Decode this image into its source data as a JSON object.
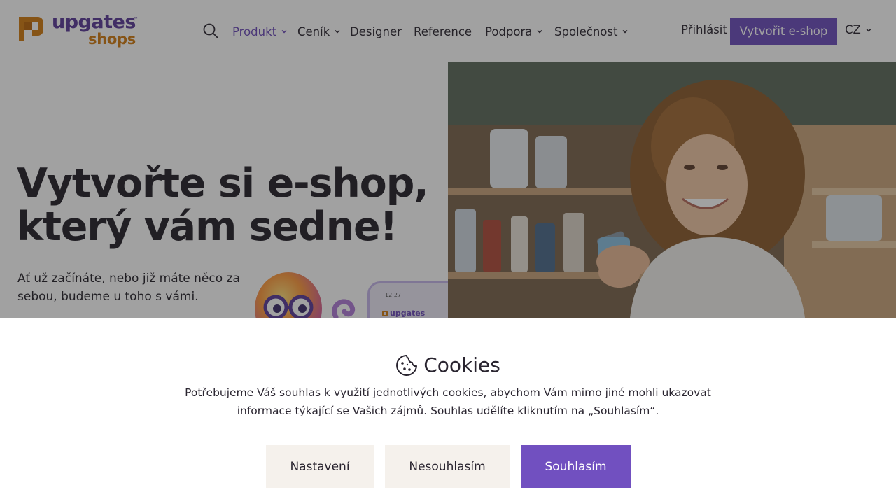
{
  "header": {
    "logo_word": "upgates",
    "logo_tm": "™",
    "logo_sub": "shops",
    "nav": [
      {
        "label": "Produkt",
        "dropdown": true,
        "active": true
      },
      {
        "label": "Ceník",
        "dropdown": true
      },
      {
        "label": "Designer",
        "dropdown": false
      },
      {
        "label": "Reference",
        "dropdown": false
      },
      {
        "label": "Podpora",
        "dropdown": true
      },
      {
        "label": "Společnost",
        "dropdown": true
      }
    ],
    "login_label": "Přihlásit",
    "cta_label": "Vytvořit e-shop",
    "lang_label": "CZ"
  },
  "hero": {
    "title_line1": "Vytvořte si e-shop,",
    "title_line2": "který vám sedne!",
    "subtitle": "Ať už začínáte, nebo již máte něco za sebou, budeme u toho s vámi.",
    "phone_time": "12:27",
    "phone_brand": "upgates"
  },
  "cookie": {
    "title": "Cookies",
    "text": "Potřebujeme Váš souhlas k využití jednotlivých cookies, abychom Vám mimo jiné mohli ukazovat informace týkající se Vašich zájmů. Souhlas udělíte kliknutím na „Souhlasím“.",
    "settings_label": "Nastavení",
    "decline_label": "Nesouhlasím",
    "accept_label": "Souhlasím"
  },
  "colors": {
    "brand_purple": "#6c4cbc",
    "brand_orange": "#d07a10",
    "accept_button": "#7150c0",
    "neutral_button": "#f5f1ec"
  },
  "icons": [
    "upgates-logo-icon",
    "search-icon",
    "chevron-down-icon",
    "cookie-icon",
    "mascot-octopus-icon"
  ]
}
